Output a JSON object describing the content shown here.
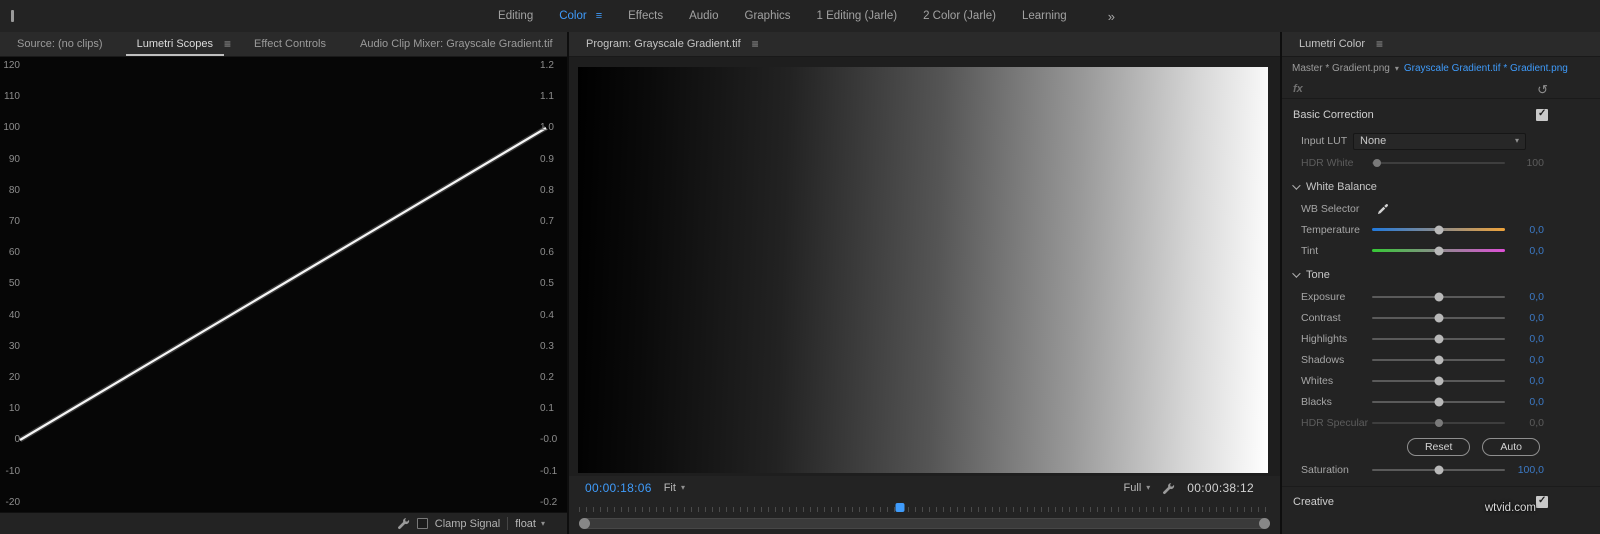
{
  "watermark": "wtvid.com",
  "top_bar": {
    "tabs": [
      {
        "label": "Editing"
      },
      {
        "label": "Color"
      },
      {
        "label": "Effects"
      },
      {
        "label": "Audio"
      },
      {
        "label": "Graphics"
      },
      {
        "label": "1 Editing (Jarle)"
      },
      {
        "label": "2 Color (Jarle)"
      },
      {
        "label": "Learning"
      }
    ],
    "active_tab": "Color",
    "overflow_label": "»",
    "accent_color": "#3f9bfa"
  },
  "left_panel": {
    "tabs": {
      "source": "Source: (no clips)",
      "lumetri_scopes": "Lumetri Scopes",
      "effect_controls": "Effect Controls",
      "audio_clip_mixer": "Audio Clip Mixer: Grayscale Gradient.tif"
    },
    "active_tab": "Lumetri Scopes",
    "scope": {
      "type": "waveform",
      "left_axis": [
        "120",
        "110",
        "100",
        "90",
        "80",
        "70",
        "60",
        "50",
        "40",
        "30",
        "20",
        "10",
        "0",
        "-10",
        "-20"
      ],
      "right_axis": [
        "1.2",
        "1.1",
        "1.0",
        "0.9",
        "0.8",
        "0.7",
        "0.6",
        "0.5",
        "0.4",
        "0.3",
        "0.2",
        "0.1",
        "-0.0",
        "-0.1",
        "-0.2"
      ],
      "waveform_description": "straight diagonal trace from level 0 at left to level 100 at right"
    },
    "footer": {
      "clamp_signal_label": "Clamp Signal",
      "clamp_signal_checked": false,
      "format_value": "float"
    }
  },
  "program": {
    "tab_label": "Program: Grayscale Gradient.tif",
    "timecode": "00:00:18:06",
    "zoom_level": "Fit",
    "playback_resolution": "Full",
    "duration": "00:00:38:12",
    "playhead_fraction": 0.465
  },
  "lumetri": {
    "tab_label": "Lumetri Color",
    "master_clip": "Master * Gradient.png",
    "selected_clip": "Grayscale Gradient.tif * Gradient.png",
    "fx_label": "fx",
    "basic_correction": {
      "title": "Basic Correction",
      "enabled": true,
      "input_lut": {
        "label": "Input LUT",
        "value": "None"
      },
      "hdr_white": {
        "label": "HDR White",
        "value": "100",
        "disabled": true
      },
      "white_balance": {
        "title": "White Balance",
        "wb_selector_label": "WB Selector",
        "temperature": {
          "label": "Temperature",
          "value": "0,0"
        },
        "tint": {
          "label": "Tint",
          "value": "0,0"
        }
      },
      "tone": {
        "title": "Tone",
        "rows": [
          {
            "label": "Exposure",
            "value": "0,0"
          },
          {
            "label": "Contrast",
            "value": "0,0"
          },
          {
            "label": "Highlights",
            "value": "0,0"
          },
          {
            "label": "Shadows",
            "value": "0,0"
          },
          {
            "label": "Whites",
            "value": "0,0"
          },
          {
            "label": "Blacks",
            "value": "0,0"
          }
        ],
        "hdr_specular": {
          "label": "HDR Specular",
          "value": "0,0",
          "disabled": true
        }
      },
      "reset_button": "Reset",
      "auto_button": "Auto",
      "saturation": {
        "label": "Saturation",
        "value": "100,0"
      }
    },
    "creative": {
      "title": "Creative",
      "enabled": true
    }
  }
}
